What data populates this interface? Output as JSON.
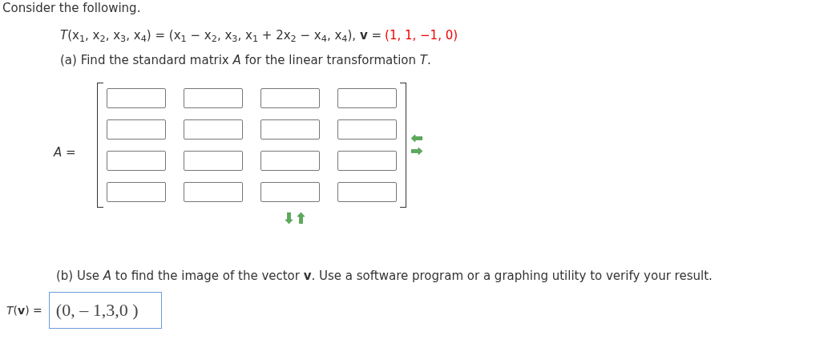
{
  "intro": "Consider the following.",
  "transformation": "*T*(x$_{1}$, x$_{2}$, x$_{3}$, x$_{4}$) = (x$_{1}$ − x$_{2}$, x$_{3}$, x$_{1}$ + 2x$_{2}$ − x$_{4}$, x$_{4}$), **v** =",
  "vector": "(1, 1, −1, 0)",
  "part_a": {
    "prompt": "(a) Find the standard matrix *A* for the linear transformation *T*.",
    "matrix_label": "*A* =",
    "matrix_rows": [
      {
        "cells": [
          {
            "kind": "input"
          },
          {
            "kind": "input"
          },
          {
            "kind": "input"
          },
          {
            "kind": "input"
          }
        ]
      },
      {
        "cells": [
          {
            "kind": "input"
          },
          {
            "kind": "input"
          },
          {
            "kind": "input"
          },
          {
            "kind": "input"
          }
        ]
      },
      {
        "cells": [
          {
            "kind": "input"
          },
          {
            "kind": "input"
          },
          {
            "kind": "input"
          },
          {
            "kind": "input"
          }
        ]
      },
      {
        "cells": [
          {
            "kind": "input"
          },
          {
            "kind": "input"
          },
          {
            "kind": "input"
          },
          {
            "kind": "input"
          }
        ]
      }
    ]
  },
  "part_b": {
    "prompt": "(b) Use *A* to find the image of the vector **v**. Use a software program or a graphing utility to verify your result.",
    "answer_label": "*T*(**v**) =",
    "answer_value": "(0, – 1,3,0 )"
  }
}
